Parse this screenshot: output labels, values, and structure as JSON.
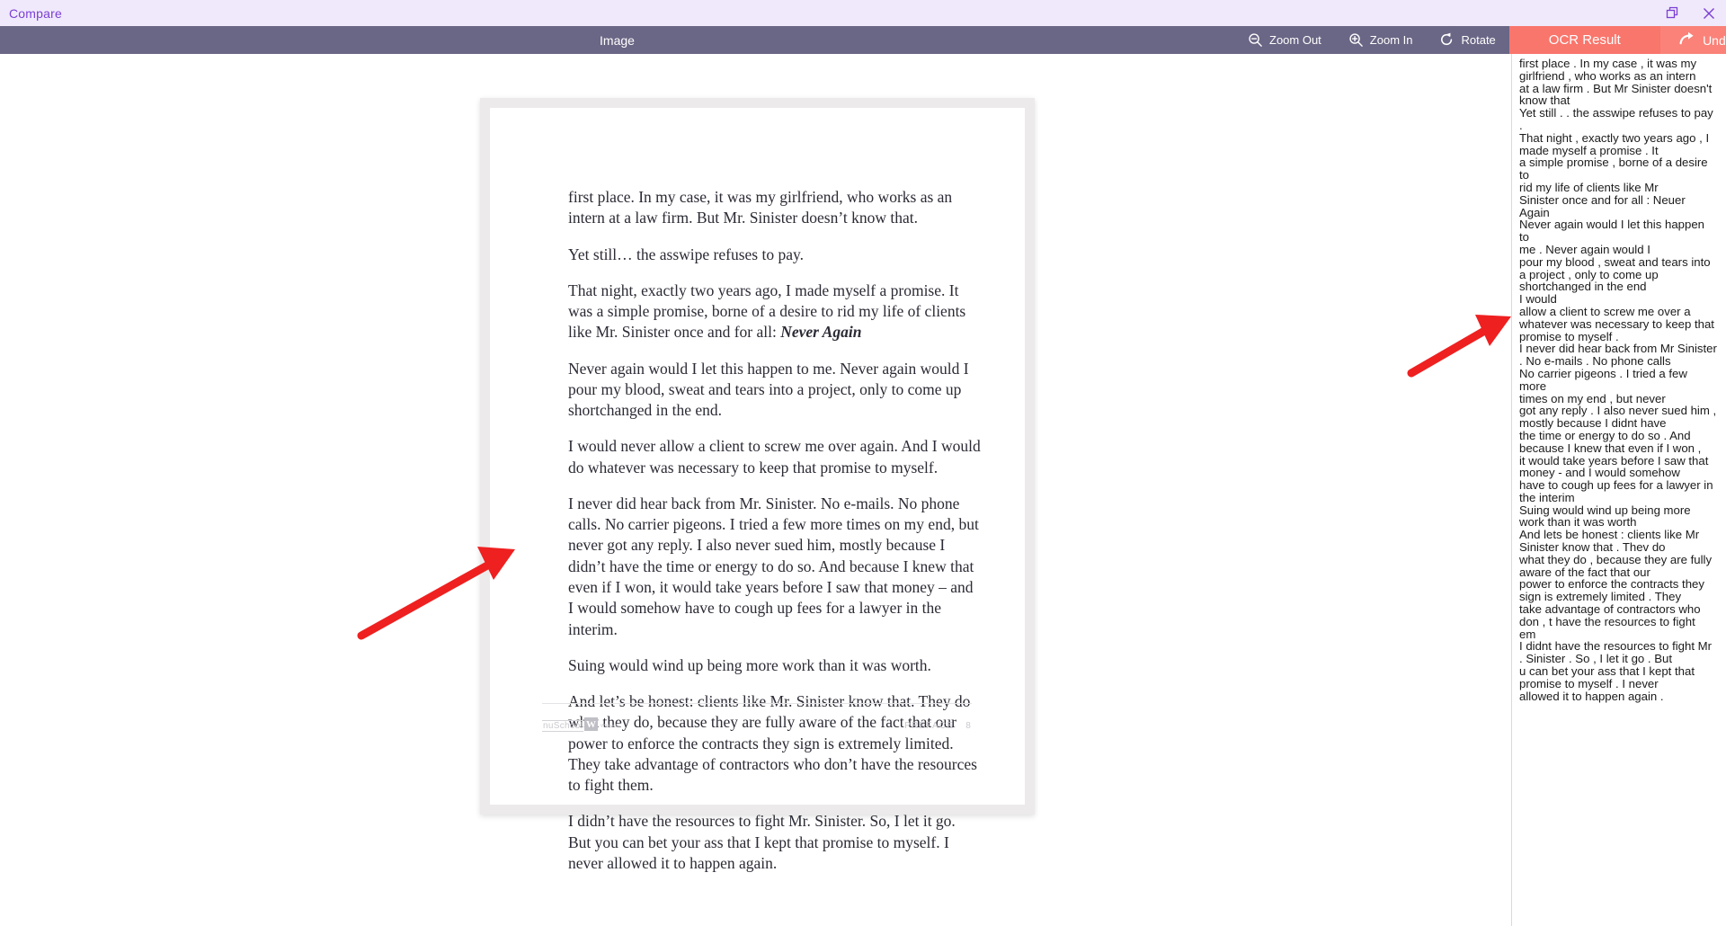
{
  "window": {
    "app_title": "Compare",
    "restore_icon": "restore-window-icon",
    "close_icon": "close-icon"
  },
  "toolbar": {
    "pane_label": "Image",
    "zoom_out_label": "Zoom Out",
    "zoom_out_icon": "zoom-out-icon",
    "zoom_in_label": "Zoom In",
    "zoom_in_icon": "zoom-in-icon",
    "rotate_label": "Rotate",
    "rotate_icon": "rotate-icon",
    "ocr_result_label": "OCR Result",
    "undo_label": "Undo",
    "undo_icon": "undo-arrow-icon",
    "colors": {
      "titlebar_bg": "#f0e9fb",
      "title_text": "#7b3fd4",
      "toolbar_bg": "#6a6685",
      "ocr_button_bg": "#f9766c",
      "undo_button_bg": "#fa8279",
      "arrow_red": "#ef2020"
    }
  },
  "document": {
    "paragraphs": [
      "first place. In my case, it was my girlfriend, who works as an intern at a law firm. But Mr. Sinister doesn’t know that.",
      "Yet still… the asswipe refuses to pay.",
      "That night, exactly two years ago, I made myself a promise. It was a simple promise, borne of a desire to rid my life of clients like Mr. Sinister once and for all: ",
      "Never again would I let this happen to me. Never again would I pour my blood, sweat and tears into a project, only to come up shortchanged in the end.",
      "I would never allow a client to screw me over again. And I would do whatever was necessary to keep that promise to myself.",
      "I never did hear back from Mr. Sinister. No e-mails. No phone calls. No carrier pigeons. I tried a few more times on my end, but never got any reply. I also never sued him, mostly because I didn’t have the time or energy to do so. And because I knew that even if I won, it would take years before I saw that money – and I would somehow have to cough up fees for a lawyer in the interim.",
      "Suing would wind up being more work than it was worth.",
      "And let’s be honest: clients like Mr. Sinister know that. They do what they do, because they are fully aware of the fact that our power to enforce the contracts they sign is extremely limited. They take advantage of contractors who don’t have the resources to fight them.",
      "I didn’t have the resources to fight Mr. Sinister. So, I let it go. But you can bet your ass that I kept that promise to myself. I never allowed it to happen again."
    ],
    "emphasis_phrase": "Never Again",
    "footer": {
      "brand_left": "nuSchool",
      "watermark_letter": "W",
      "watermark_caption": "Wikipedia",
      "section_label": "PREFACE",
      "page_number": "8"
    }
  },
  "ocr": {
    "text": "first place . In my case , it was my\ngirlfriend , who works as an intern\nat a law firm . But Mr Sinister doesn't\nknow that\nYet still . . the asswipe refuses to pay .\nThat night , exactly two years ago , I\nmade myself a promise . It\na simple promise , borne of a desire to\nrid my life of clients like Mr\nSinister once and for all : Neuer Again\nNever again would I let this happen to\nme . Never again would I\npour my blood , sweat and tears into\na project , only to come up\nshortchanged in the end\nI would\nallow a client to screw me over a\nwhatever was necessary to keep that\npromise to myself .\nI never did hear back from Mr Sinister\n. No e-mails . No phone calls\nNo carrier pigeons . I tried a few more\ntimes on my end , but never\ngot any reply . I also never sued him ,\nmostly because I didnt have\nthe time or energy to do so . And\nbecause I knew that even if I won ,\nit would take years before I saw that\nmoney - and I would somehow\nhave to cough up fees for a lawyer in\nthe interim\nSuing would wind up being more\nwork than it was worth\nAnd lets be honest : clients like Mr\nSinister know that . Thev do\nwhat they do , because they are fully\naware of the fact that our\npower to enforce the contracts they\nsign is extremely limited . They\ntake advantage of contractors who\ndon , t have the resources to fight\nem\nI didnt have the resources to fight Mr\n. Sinister . So , I let it go . But\nu can bet your ass that I kept that\npromise to myself . I never\nallowed it to happen again ."
  },
  "annotations": {
    "arrow_left_name": "red-arrow-annotation-left",
    "arrow_right_name": "red-arrow-annotation-right"
  }
}
